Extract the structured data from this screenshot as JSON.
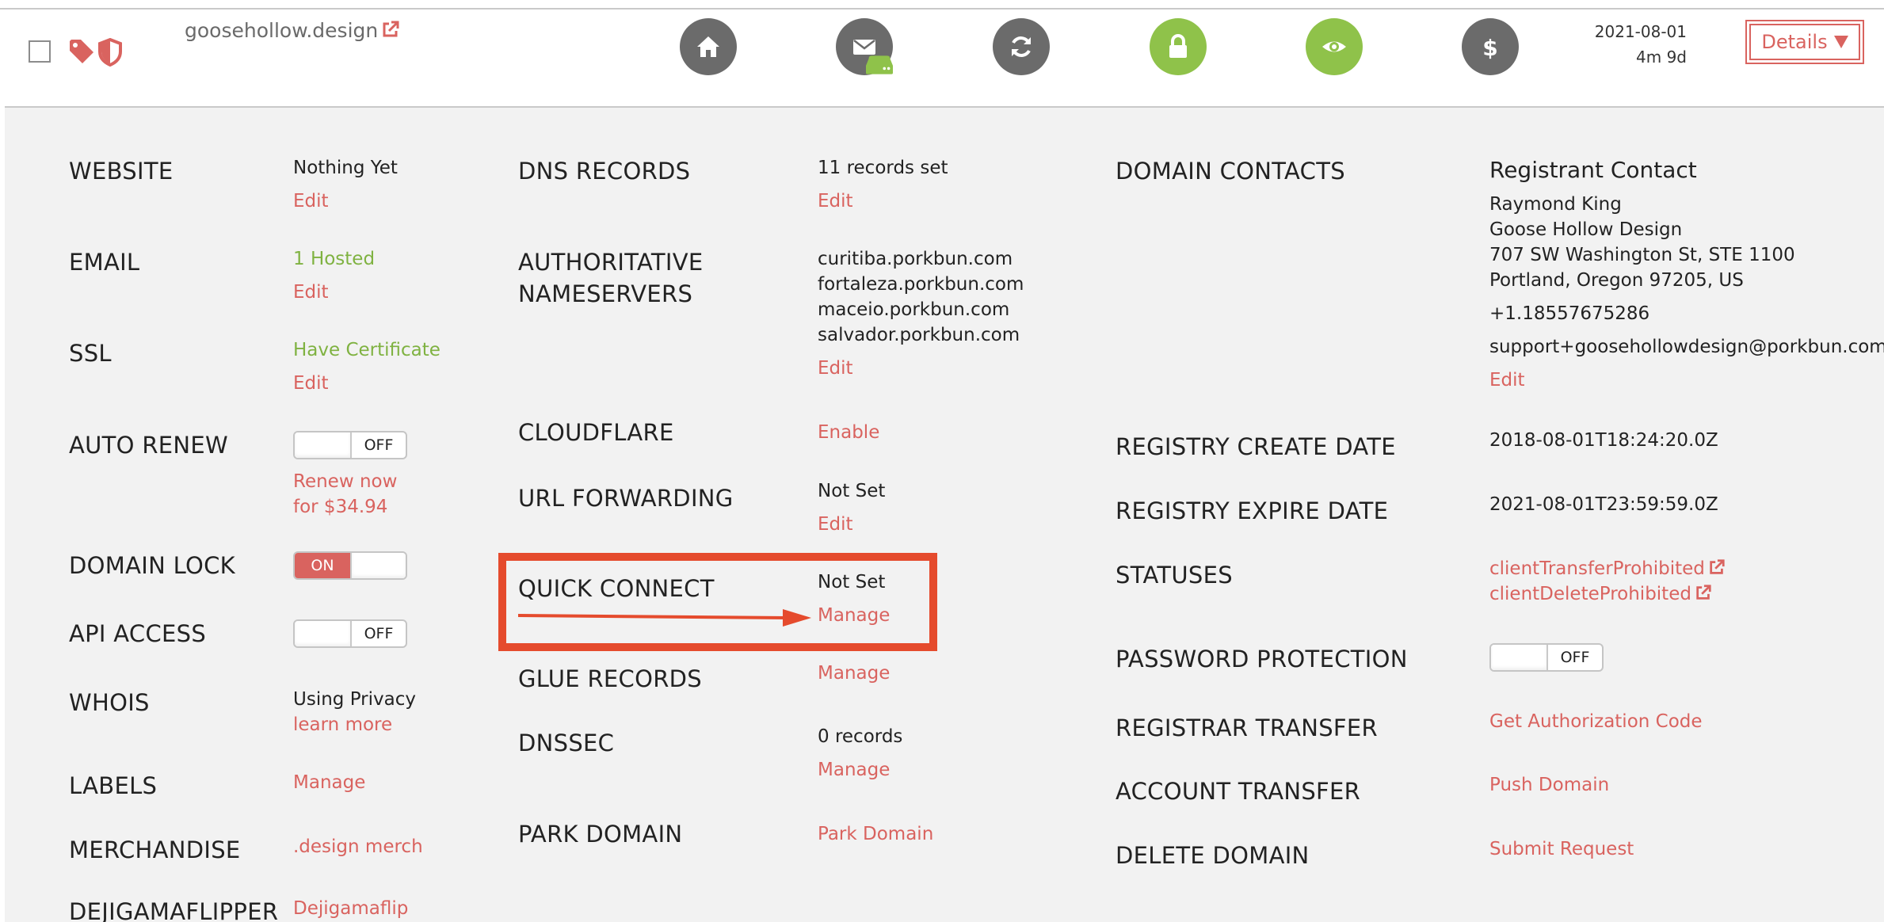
{
  "domain_row": {
    "domain": "goosehollow.design",
    "expire_date": "2021-08-01",
    "time_left": "4m 9d",
    "details_label": "Details",
    "action_icons": [
      "home-icon",
      "envelope-icon",
      "refresh-icon",
      "lock-icon",
      "eye-icon",
      "dollar-icon"
    ],
    "status_icons": [
      "tag-icon",
      "shield-icon"
    ]
  },
  "column1": {
    "website": {
      "label": "WEBSITE",
      "value": "Nothing Yet",
      "link": "Edit"
    },
    "email": {
      "label": "EMAIL",
      "value": "1 Hosted",
      "link": "Edit"
    },
    "ssl": {
      "label": "SSL",
      "value": "Have Certificate",
      "link": "Edit"
    },
    "auto_renew": {
      "label": "AUTO RENEW",
      "toggle": "OFF",
      "link_line1": "Renew now",
      "link_line2": "for $34.94"
    },
    "domain_lock": {
      "label": "DOMAIN LOCK",
      "toggle": "ON"
    },
    "api_access": {
      "label": "API ACCESS",
      "toggle": "OFF"
    },
    "whois": {
      "label": "WHOIS",
      "value": "Using Privacy",
      "link": "learn more"
    },
    "labels": {
      "label": "LABELS",
      "link": "Manage"
    },
    "merchandise": {
      "label": "MERCHANDISE",
      "link": ".design merch"
    },
    "dejigamaflipper": {
      "label": "DEJIGAMAFLIPPER",
      "link": "Dejigamaflip"
    }
  },
  "column2": {
    "dns_records": {
      "label": "DNS RECORDS",
      "value": "11 records set",
      "link": "Edit"
    },
    "nameservers": {
      "label_line1": "AUTHORITATIVE",
      "label_line2": "NAMESERVERS",
      "values": [
        "curitiba.porkbun.com",
        "fortaleza.porkbun.com",
        "maceio.porkbun.com",
        "salvador.porkbun.com"
      ],
      "link": "Edit"
    },
    "cloudflare": {
      "label": "CLOUDFLARE",
      "link": "Enable"
    },
    "url_forwarding": {
      "label": "URL FORWARDING",
      "value": "Not Set",
      "link": "Edit"
    },
    "quick_connect": {
      "label": "QUICK CONNECT",
      "value": "Not Set",
      "link": "Manage"
    },
    "glue_records": {
      "label": "GLUE RECORDS",
      "link": "Manage"
    },
    "dnssec": {
      "label": "DNSSEC",
      "value": "0 records",
      "link": "Manage"
    },
    "park_domain": {
      "label": "PARK DOMAIN",
      "link": "Park Domain"
    }
  },
  "column3": {
    "domain_contacts": {
      "label": "DOMAIN CONTACTS",
      "heading": "Registrant Contact",
      "lines": [
        "Raymond King",
        "Goose Hollow Design",
        "707 SW Washington St, STE 1100",
        "Portland, Oregon 97205, US"
      ],
      "phone": "+1.18557675286",
      "email": "support+goosehollowdesign@porkbun.com",
      "link": "Edit"
    },
    "create_date": {
      "label": "REGISTRY CREATE DATE",
      "value": "2018-08-01T18:24:20.0Z"
    },
    "expire_date": {
      "label": "REGISTRY EXPIRE DATE",
      "value": "2021-08-01T23:59:59.0Z"
    },
    "statuses": {
      "label": "STATUSES",
      "links": [
        "clientTransferProhibited",
        "clientDeleteProhibited"
      ]
    },
    "password_protection": {
      "label": "PASSWORD PROTECTION",
      "toggle": "OFF"
    },
    "registrar_transfer": {
      "label": "REGISTRAR TRANSFER",
      "link": "Get Authorization Code"
    },
    "account_transfer": {
      "label": "ACCOUNT TRANSFER",
      "link": "Push Domain"
    },
    "delete_domain": {
      "label": "DELETE DOMAIN",
      "link": "Submit Request"
    }
  },
  "colors": {
    "accent": "#d9635f",
    "green": "#8fc24a",
    "icon_gray": "#6b6b6b",
    "panel_bg": "#f2f2f2",
    "highlight": "#e54b2d"
  }
}
